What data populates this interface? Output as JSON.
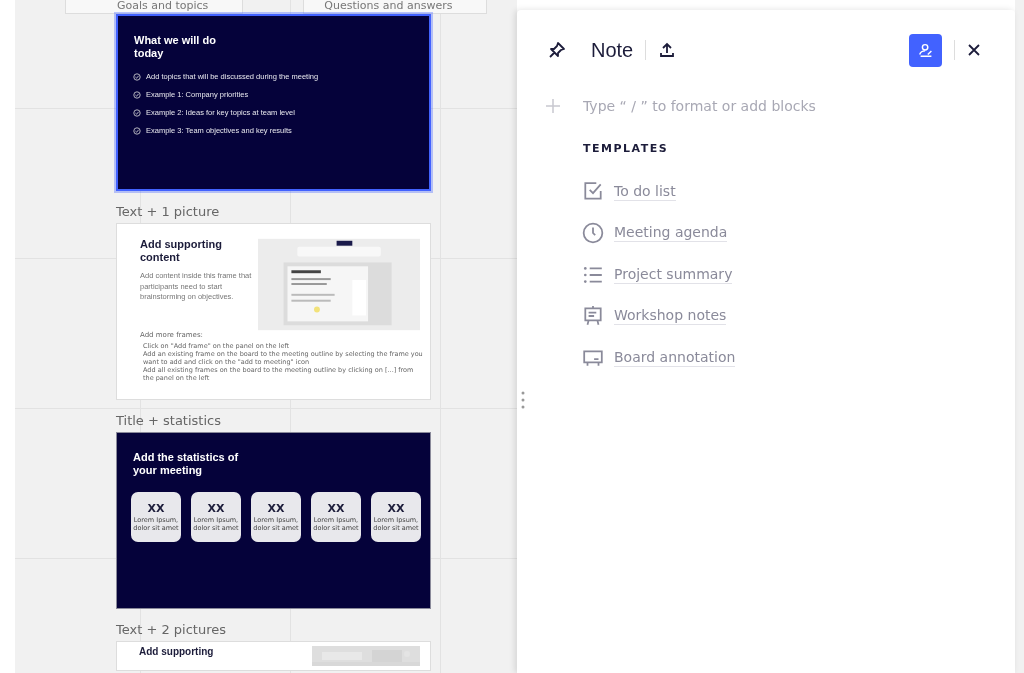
{
  "board": {
    "header_labels": [
      "Goals and topics",
      "Questions and answers"
    ],
    "frames": [
      {
        "kind": "agenda",
        "selected": true,
        "title": "What we will do today",
        "items": [
          "Add topics that will be discussed during the meeting",
          "Example 1: Company priorities",
          "Example 2: Ideas for key topics at team level",
          "Example 3: Team objectives and key results"
        ]
      },
      {
        "kind": "text_picture",
        "label": "Text + 1 picture",
        "selected": false,
        "title": "Add supporting content",
        "body": "Add content inside this frame that participants need to start brainstorming on objectives.",
        "subheading": "Add more frames:",
        "bullets": [
          "Click on \"Add frame\" on the panel on the left",
          "Add an existing frame on the board to the meeting outline by selecting the frame you want to add and click on the \"add to meeting\" icon",
          "Add all existing frames on the board to the meeting outline by clicking on [...] from the panel on the left"
        ]
      },
      {
        "kind": "statistics",
        "label": "Title + statistics",
        "selected": false,
        "title": "Add the statistics of your meeting",
        "stats": [
          {
            "value": "XX",
            "caption": "Lorem Ipsum, dolor sit amet"
          },
          {
            "value": "XX",
            "caption": "Lorem Ipsum, dolor sit amet"
          },
          {
            "value": "XX",
            "caption": "Lorem Ipsum, dolor sit amet"
          },
          {
            "value": "XX",
            "caption": "Lorem Ipsum, dolor sit amet"
          },
          {
            "value": "XX",
            "caption": "Lorem Ipsum, dolor sit amet"
          }
        ]
      },
      {
        "kind": "text_pictures",
        "label": "Text + 2 pictures",
        "selected": false,
        "title": "Add supporting"
      }
    ]
  },
  "note_panel": {
    "title": "Note",
    "editor": {
      "placeholder": "Type “ / ” to format or add blocks"
    },
    "templates_heading": "TEMPLATES",
    "templates": [
      {
        "kind": "checklist",
        "label": "To do list"
      },
      {
        "kind": "clock",
        "label": "Meeting agenda"
      },
      {
        "kind": "list",
        "label": "Project summary"
      },
      {
        "kind": "easel",
        "label": "Workshop notes"
      },
      {
        "kind": "board",
        "label": "Board annotation"
      }
    ]
  }
}
